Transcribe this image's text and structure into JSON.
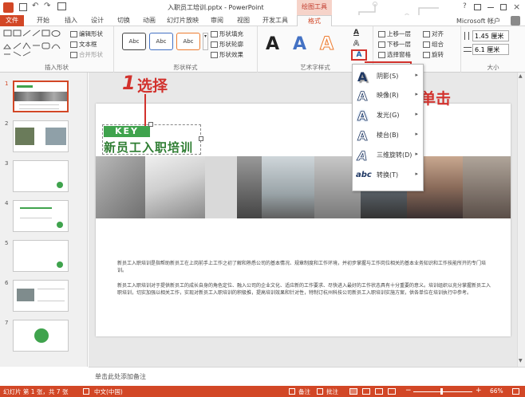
{
  "window": {
    "title": "入职员工培训.pptx - PowerPoint",
    "context_tab_group": "绘图工具",
    "help": "?",
    "account": "Microsoft 帐户"
  },
  "tabs": [
    {
      "label": "文件"
    },
    {
      "label": "开始"
    },
    {
      "label": "插入"
    },
    {
      "label": "设计"
    },
    {
      "label": "切换"
    },
    {
      "label": "动画"
    },
    {
      "label": "幻灯片放映"
    },
    {
      "label": "审阅"
    },
    {
      "label": "视图"
    },
    {
      "label": "开发工具"
    },
    {
      "label": "格式"
    }
  ],
  "ribbon": {
    "insert_shapes": {
      "label": "插入形状",
      "edit_shape": "编辑形状",
      "text_box": "文本框",
      "merge_shapes": "合并形状"
    },
    "shape_styles": {
      "label": "形状样式",
      "swatch_text": "Abc",
      "fill": "形状填充",
      "outline": "形状轮廓",
      "effects": "形状效果"
    },
    "wordart_styles": {
      "label": "艺术字样式",
      "glyph": "A"
    },
    "arrange": {
      "bring_forward": "上移一层",
      "send_backward": "下移一层",
      "selection_pane": "选择窗格",
      "align": "对齐",
      "group": "组合",
      "rotate": "旋转"
    },
    "size": {
      "label": "大小",
      "height": "1.45 厘米",
      "width": "6.1 厘米"
    }
  },
  "text_effects_menu": [
    {
      "label": "阴影(S)"
    },
    {
      "label": "映像(R)"
    },
    {
      "label": "发光(G)"
    },
    {
      "label": "棱台(B)"
    },
    {
      "label": "三维旋转(D)"
    },
    {
      "label": "转换(T)"
    }
  ],
  "thumbnails": [
    {
      "num": "1"
    },
    {
      "num": "2"
    },
    {
      "num": "3"
    },
    {
      "num": "4"
    },
    {
      "num": "5"
    },
    {
      "num": "6"
    },
    {
      "num": "7"
    }
  ],
  "slide": {
    "key_label": "KEY",
    "title": "新员工入职培训",
    "para1": "新员工入职培训是指帮助新员工在上岗前手上工作之初了解和熟悉公司的基本情况、规章制度和工作环境，并初步掌握与工作岗位相关的基本业务知识和工作技能所开的专门培训。",
    "para2": "新员工入职培训对于提供新员工的成长自身的角色定位、融入公司的企业文化、适应新的工作要求、尽快进入最好的工作状态具有十分重要的意义。培训组织以充分掌握新员工入职培训，切实加强以相关工作，实现对新员工入职培训的积极推，提高培训效果和针对性，特制订杭州科技公司新员工入职培训实施方案，供各单位在培训执行中参考。"
  },
  "callouts": {
    "step1_num": "1",
    "step1_text": "选择",
    "step2_num": "2",
    "step2_text": "单击"
  },
  "notes_placeholder": "单击此处添加备注",
  "status": {
    "slide_info": "幻灯片 第 1 张，共 7 张",
    "language": "中文(中国)",
    "notes": "备注",
    "comments": "批注",
    "zoom": "66%"
  },
  "colors": {
    "accent": "#d24726",
    "green": "#3fa34d",
    "callout_red": "#d2322d"
  }
}
